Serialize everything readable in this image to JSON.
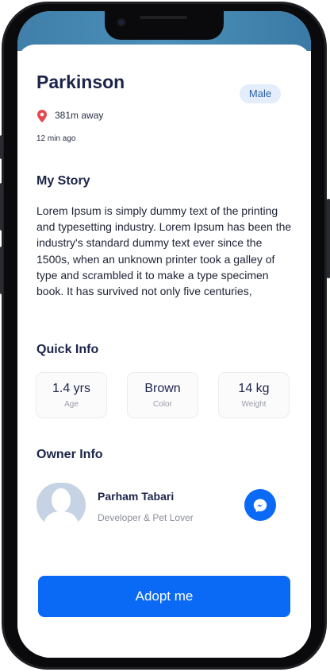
{
  "pet": {
    "name": "Parkinson",
    "gender": "Male",
    "distance": "381m away",
    "posted": "12 min ago"
  },
  "story": {
    "heading": "My Story",
    "text": "Lorem Ipsum is simply dummy text of the printing and typesetting industry. Lorem Ipsum has been the industry's standard dummy text ever since the 1500s, when an unknown printer took a galley of type and scrambled it to make a type specimen book. It has survived not only five centuries,"
  },
  "quick_info": {
    "heading": "Quick Info",
    "items": [
      {
        "value": "1.4 yrs",
        "label": "Age"
      },
      {
        "value": "Brown",
        "label": "Color"
      },
      {
        "value": "14 kg",
        "label": "Weight"
      }
    ]
  },
  "owner": {
    "heading": "Owner Info",
    "name": "Parham Tabari",
    "role": "Developer & Pet Lover",
    "contact_icon": "messenger-icon"
  },
  "actions": {
    "adopt_label": "Adopt me"
  },
  "colors": {
    "primary": "#0a6af5",
    "title": "#1c2449",
    "badge_bg": "#e3edfb",
    "pin": "#e5484d"
  }
}
